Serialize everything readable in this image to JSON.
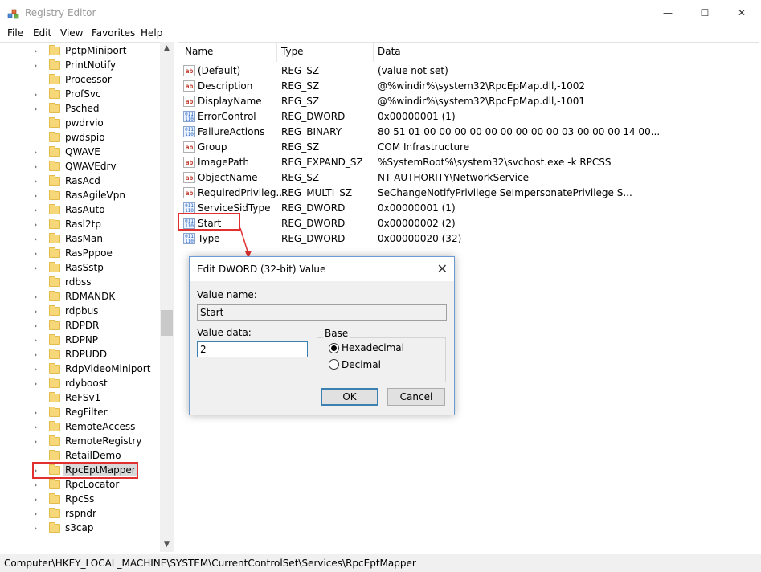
{
  "window": {
    "title": "Registry Editor",
    "minimize_glyph": "—",
    "maximize_glyph": "☐",
    "close_glyph": "✕"
  },
  "menu": [
    "File",
    "Edit",
    "View",
    "Favorites",
    "Help"
  ],
  "tree": {
    "items": [
      "PptpMiniport",
      "PrintNotify",
      "Processor",
      "ProfSvc",
      "Psched",
      "pwdrvio",
      "pwdspio",
      "QWAVE",
      "QWAVEdrv",
      "RasAcd",
      "RasAgileVpn",
      "RasAuto",
      "Rasl2tp",
      "RasMan",
      "RasPppoe",
      "RasSstp",
      "rdbss",
      "RDMANDK",
      "rdpbus",
      "RDPDR",
      "RDPNP",
      "RDPUDD",
      "RdpVideoMiniport",
      "rdyboost",
      "ReFSv1",
      "RegFilter",
      "RemoteAccess",
      "RemoteRegistry",
      "RetailDemo",
      "RpcEptMapper",
      "RpcLocator",
      "RpcSs",
      "rspndr",
      "s3cap"
    ],
    "selected": "RpcEptMapper",
    "no_expander": [
      "Processor",
      "pwdrvio",
      "pwdspio",
      "rdbss",
      "ReFSv1",
      "RetailDemo"
    ]
  },
  "list": {
    "headers": {
      "name": "Name",
      "type": "Type",
      "data": "Data"
    },
    "rows": [
      {
        "icon": "string-value-icon",
        "name": "(Default)",
        "type": "REG_SZ",
        "data": "(value not set)"
      },
      {
        "icon": "string-value-icon",
        "name": "Description",
        "type": "REG_SZ",
        "data": "@%windir%\\system32\\RpcEpMap.dll,-1002"
      },
      {
        "icon": "string-value-icon",
        "name": "DisplayName",
        "type": "REG_SZ",
        "data": "@%windir%\\system32\\RpcEpMap.dll,-1001"
      },
      {
        "icon": "binary-value-icon",
        "name": "ErrorControl",
        "type": "REG_DWORD",
        "data": "0x00000001 (1)"
      },
      {
        "icon": "binary-value-icon",
        "name": "FailureActions",
        "type": "REG_BINARY",
        "data": "80 51 01 00 00 00 00 00 00 00 00 00 03 00 00 00 14 00..."
      },
      {
        "icon": "string-value-icon",
        "name": "Group",
        "type": "REG_SZ",
        "data": "COM Infrastructure"
      },
      {
        "icon": "string-value-icon",
        "name": "ImagePath",
        "type": "REG_EXPAND_SZ",
        "data": "%SystemRoot%\\system32\\svchost.exe -k RPCSS"
      },
      {
        "icon": "string-value-icon",
        "name": "ObjectName",
        "type": "REG_SZ",
        "data": "NT AUTHORITY\\NetworkService"
      },
      {
        "icon": "string-value-icon",
        "name": "RequiredPrivileg...",
        "type": "REG_MULTI_SZ",
        "data": "SeChangeNotifyPrivilege SeImpersonatePrivilege S..."
      },
      {
        "icon": "binary-value-icon",
        "name": "ServiceSidType",
        "type": "REG_DWORD",
        "data": "0x00000001 (1)"
      },
      {
        "icon": "binary-value-icon",
        "name": "Start",
        "type": "REG_DWORD",
        "data": "0x00000002 (2)"
      },
      {
        "icon": "binary-value-icon",
        "name": "Type",
        "type": "REG_DWORD",
        "data": "0x00000020 (32)"
      }
    ]
  },
  "dialog": {
    "title": "Edit DWORD (32-bit) Value",
    "value_name_label": "Value name:",
    "value_name": "Start",
    "value_data_label": "Value data:",
    "value_data": "2",
    "base_label": "Base",
    "radio_hex": "Hexadecimal",
    "radio_dec": "Decimal",
    "selected_base": "Hexadecimal",
    "ok": "OK",
    "cancel": "Cancel",
    "close_glyph": "✕"
  },
  "status": {
    "path": "Computer\\HKEY_LOCAL_MACHINE\\SYSTEM\\CurrentControlSet\\Services\\RpcEptMapper"
  },
  "colors": {
    "highlight": "#e03030",
    "dialog_border": "#6b9ad5",
    "folder": "#f6d77a"
  }
}
